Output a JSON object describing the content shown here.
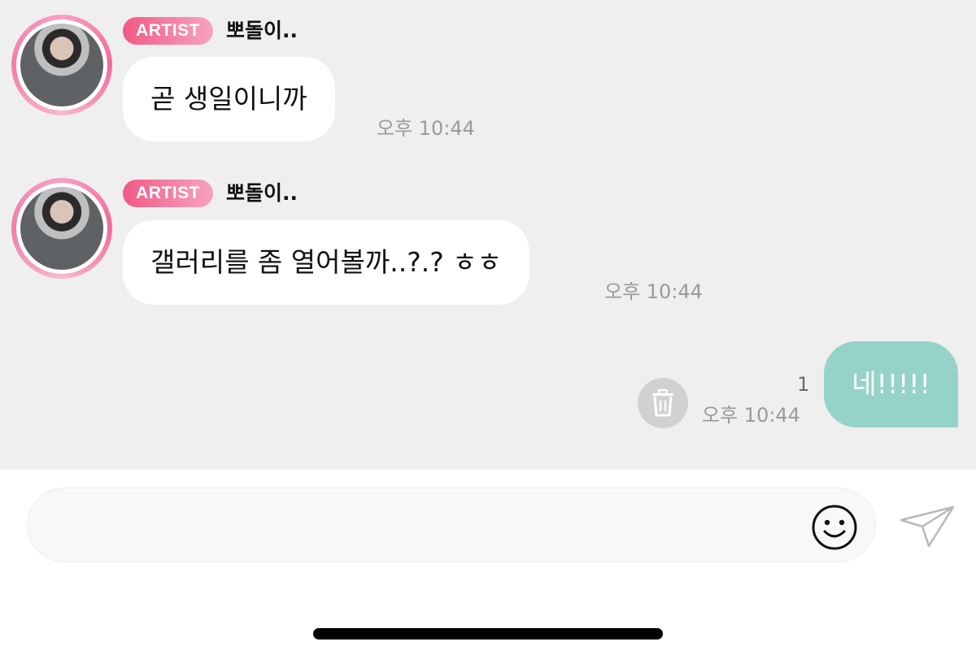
{
  "messages": [
    {
      "badge": "ARTIST",
      "sender": "뽀돌이..",
      "text": "곧 생일이니까",
      "time": "오후 10:44"
    },
    {
      "badge": "ARTIST",
      "sender": "뽀돌이..",
      "text": "갤러리를 좀 열어볼까..?.? ㅎㅎ",
      "time": "오후 10:44"
    }
  ],
  "my_message": {
    "text": "네!!!!!",
    "read_count": "1",
    "time": "오후 10:44"
  },
  "composer": {
    "placeholder": ""
  },
  "icons": {
    "delete": "trash-icon",
    "emoji": "smiley-icon",
    "send": "paper-plane-icon"
  },
  "colors": {
    "chat_background": "#efefef",
    "artist_badge": "#f05a86",
    "my_bubble": "#95d3c9",
    "incoming_bubble": "#ffffff"
  }
}
